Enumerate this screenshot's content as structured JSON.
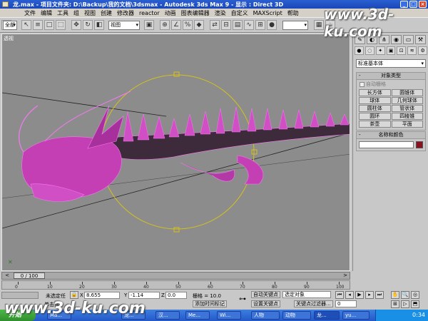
{
  "window": {
    "title": "龙.max    - 项目文件夹: D:\\Backup\\我的文档\\3dsmax    - Autodesk 3ds Max 9    - 显示 : Direct 3D"
  },
  "menu": {
    "items": [
      "文件",
      "编辑",
      "工具",
      "组",
      "视图",
      "创建",
      "修改器",
      "reactor",
      "动画",
      "图表编辑器",
      "渲染",
      "自定义",
      "MAXScript",
      "帮助"
    ]
  },
  "toolbar": {
    "selection_filter": "全部",
    "coord_system": "视图"
  },
  "viewport": {
    "label": "透视"
  },
  "command_panel": {
    "category_dropdown": "标准基本体",
    "object_type": {
      "title": "对象类型",
      "autogrid_label": "自动栅格",
      "buttons": [
        "长方体",
        "圆锥体",
        "球体",
        "几何球体",
        "圆柱体",
        "管状体",
        "圆环",
        "四棱锥",
        "茶壶",
        "平面"
      ]
    },
    "name_color": {
      "title": "名称和颜色",
      "name_value": ""
    },
    "colors": {
      "object_color": "#8a1020"
    }
  },
  "timeline": {
    "frame_display": "0 / 100",
    "prev_arrow": "<",
    "next_arrow": ">",
    "ticks": [
      "0",
      "10",
      "20",
      "30",
      "40",
      "50",
      "60",
      "70",
      "80",
      "90",
      "100"
    ]
  },
  "status": {
    "selection_text": "未选定任",
    "x_label": "X",
    "x_value": "8.655",
    "y_label": "Y",
    "y_value": "-1.14",
    "z_label": "Z",
    "z_value": "0.0",
    "grid_text": "栅格 = 10.0",
    "add_time_tag": "添加时间标记",
    "auto_key": "自动关键点",
    "selected_dropdown": "选定对象",
    "set_key": "设置关键点",
    "key_filters": "关键点过滤器...",
    "frame_value": "0",
    "prompt_text": "单击并"
  },
  "taskbar": {
    "start_label": "开始",
    "tasks": [
      "Ma...",
      "龙...",
      "汉...",
      "Me...",
      "Wi...",
      "人物",
      "动物",
      "龙...",
      "yu..."
    ],
    "clock": "0:34"
  },
  "watermarks": {
    "top": "www.3d-ku.com",
    "bottom": "www.3d-ku.com"
  }
}
